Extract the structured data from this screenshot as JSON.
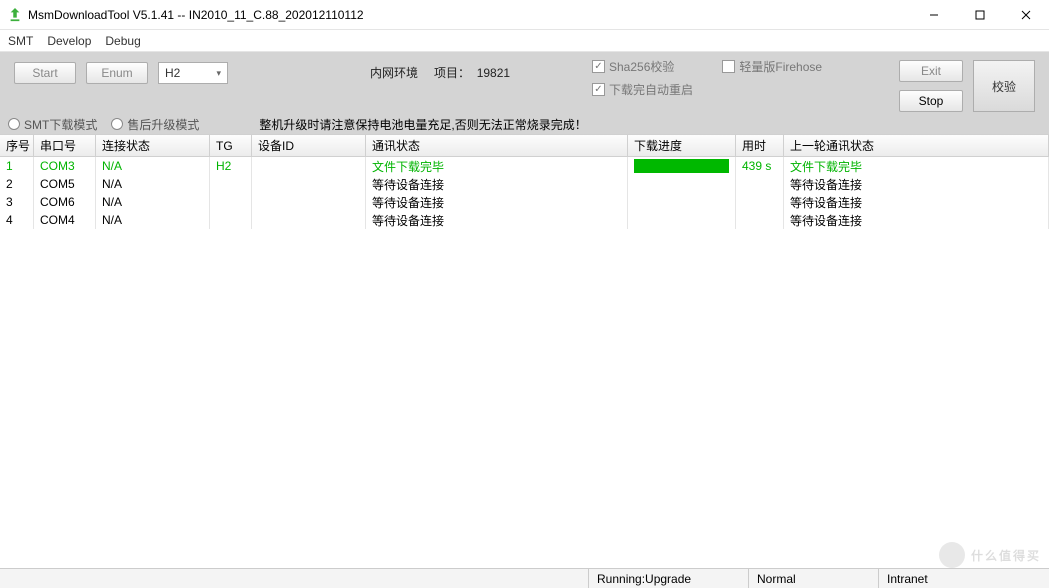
{
  "window": {
    "title": "MsmDownloadTool V5.1.41 -- IN2010_11_C.88_202012110112"
  },
  "menu": {
    "smt": "SMT",
    "develop": "Develop",
    "debug": "Debug"
  },
  "toolbar": {
    "start": "Start",
    "enum": "Enum",
    "combo_value": "H2",
    "env": "内网环境",
    "project_label": "项目：",
    "project_value": "19821",
    "chk_sha": "Sha256校验",
    "chk_lite": "轻量版Firehose",
    "chk_reboot": "下载完自动重启",
    "exit": "Exit",
    "stop": "Stop",
    "verify": "校验"
  },
  "modes": {
    "smt": "SMT下载模式",
    "aftersale": "售后升级模式",
    "warning": "整机升级时请注意保持电池电量充足,否则无法正常烧录完成！"
  },
  "columns": {
    "idx": "序号",
    "port": "串口号",
    "conn": "连接状态",
    "tg": "TG",
    "did": "设备ID",
    "comm": "通讯状态",
    "prog": "下载进度",
    "time": "用时",
    "last": "上一轮通讯状态"
  },
  "rows": [
    {
      "idx": "1",
      "port": "COM3",
      "conn": "N/A",
      "tg": "H2",
      "did": "",
      "comm": "文件下载完毕",
      "prog_full": true,
      "time": "439 s",
      "last": "文件下载完毕",
      "green": true
    },
    {
      "idx": "2",
      "port": "COM5",
      "conn": "N/A",
      "tg": "",
      "did": "",
      "comm": "等待设备连接",
      "prog_full": false,
      "time": "",
      "last": "等待设备连接",
      "green": false
    },
    {
      "idx": "3",
      "port": "COM6",
      "conn": "N/A",
      "tg": "",
      "did": "",
      "comm": "等待设备连接",
      "prog_full": false,
      "time": "",
      "last": "等待设备连接",
      "green": false
    },
    {
      "idx": "4",
      "port": "COM4",
      "conn": "N/A",
      "tg": "",
      "did": "",
      "comm": "等待设备连接",
      "prog_full": false,
      "time": "",
      "last": "等待设备连接",
      "green": false
    }
  ],
  "status": {
    "running": "Running:Upgrade",
    "mode": "Normal",
    "net": "Intranet"
  },
  "watermark": "什么值得买"
}
